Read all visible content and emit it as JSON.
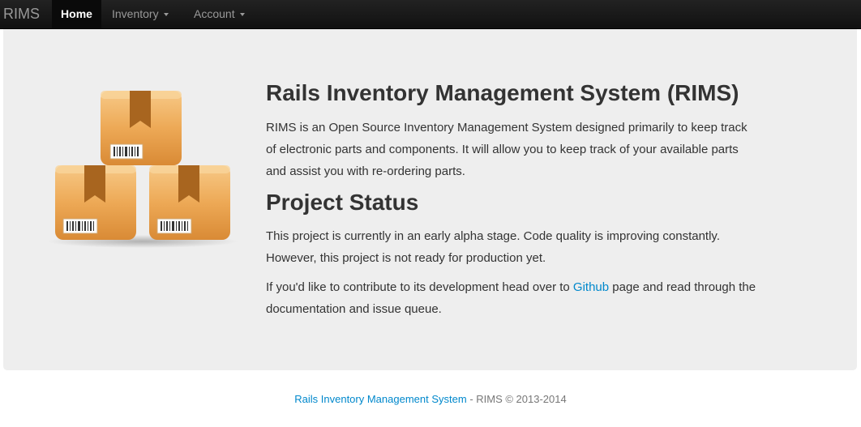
{
  "navbar": {
    "brand": "RIMS",
    "items": [
      {
        "label": "Home",
        "active": true
      },
      {
        "label": "Inventory",
        "dropdown": true
      },
      {
        "label": "Account",
        "dropdown": true
      }
    ]
  },
  "hero": {
    "image_icon": "cardboard-boxes-icon",
    "title": "Rails Inventory Management System (RIMS)",
    "description": "RIMS is an Open Source Inventory Management System designed primarily to keep track of electronic parts and components. It will allow you to keep track of your available parts and assist you with re-ordering parts.",
    "status_heading": "Project Status",
    "status_text": "This project is currently in an early alpha stage. Code quality is improving constantly. However, this project is not ready for production yet.",
    "contribute_before": "If you'd like to contribute to its development head over to ",
    "contribute_link": "Github",
    "contribute_after": " page and read through the documentation and issue queue."
  },
  "footer": {
    "link_text": "Rails Inventory Management System",
    "rest": " - RIMS © 2013-2014"
  },
  "colors": {
    "navbar": "#111111",
    "hero_bg": "#eeeeee",
    "link": "#0088cc",
    "box": "#e8a24c"
  }
}
